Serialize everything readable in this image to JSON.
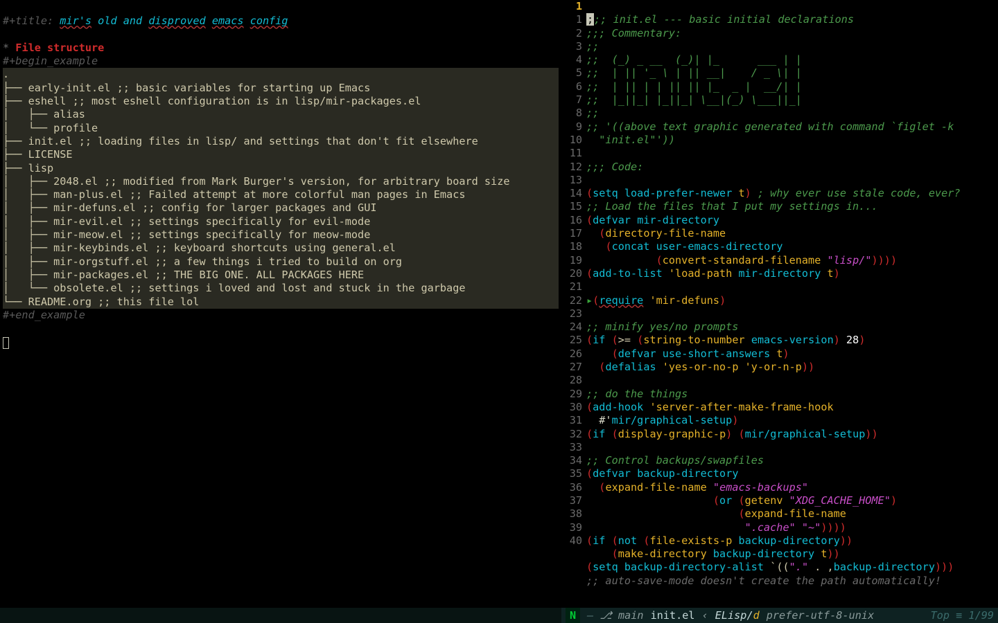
{
  "left": {
    "title_kw": "#+title: ",
    "title_words": [
      "mir's",
      "old",
      "and",
      "disproved",
      "emacs",
      "config"
    ],
    "heading_star": "* ",
    "heading": "File structure",
    "begin": "#+begin_example",
    "end": "#+end_example",
    "tree": [
      ".",
      "├── early-init.el ;; basic variables for starting up Emacs",
      "├── eshell ;; most eshell configuration is in lisp/mir-packages.el",
      "│   ├── alias",
      "│   └── profile",
      "├── init.el ;; loading files in lisp/ and settings that don't fit elsewhere",
      "├── LICENSE",
      "├── lisp",
      "│   ├── 2048.el ;; modified from Mark Burger's version, for arbitrary board size",
      "│   ├── man-plus.el ;; Failed attempt at more colorful man pages in Emacs",
      "│   ├── mir-defuns.el ;; config for larger packages and GUI",
      "│   ├── mir-evil.el ;; settings specifically for evil-mode",
      "│   ├── mir-meow.el ;; settings specifically for meow-mode",
      "│   ├── mir-keybinds.el ;; keyboard shortcuts using general.el",
      "│   ├── mir-orgstuff.el ;; a few things i tried to build on org",
      "│   ├── mir-packages.el ;; THE BIG ONE. ALL PACKAGES HERE",
      "│   └── obsolete.el ;; settings i loved and lost and stuck in the garbage",
      "└── README.org ;; this file lol"
    ]
  },
  "right": {
    "current_line_indicator": "1",
    "lines": [
      ";;; init.el --- basic initial declarations",
      ";;; Commentary:",
      ";;",
      ";;  (_) _ __  (_)| |_      ___ | |",
      ";;  | || '_ \\ | || __|    / _ \\| |",
      ";;  | || | | || || |_  _ |  __/| |",
      ";;  |_||_| |_||_| \\__|(_) \\___||_|",
      ";;",
      ";; '((above text graphic generated with command `figlet -k \"init.el\"'))",
      "",
      ";;; Code:",
      "",
      "(setq load-prefer-newer t) ; why ever use stale code, ever?",
      ";; Load the files that I put my settings in...",
      "(defvar mir-directory",
      "  (directory-file-name",
      "   (concat user-emacs-directory",
      "           (convert-standard-filename \"lisp/\"))))",
      "(add-to-list 'load-path mir-directory t)",
      "",
      "(require 'mir-defuns)",
      "",
      ";; minify yes/no prompts",
      "(if (>= (string-to-number emacs-version) 28)",
      "    (defvar use-short-answers t)",
      "  (defalias 'yes-or-no-p 'y-or-n-p))",
      "",
      ";; do the things",
      "(add-hook 'server-after-make-frame-hook #'mir/graphical-setup)",
      "(if (display-graphic-p) (mir/graphical-setup))",
      "",
      ";; Control backups/swapfiles",
      "(defvar backup-directory",
      "  (expand-file-name \"emacs-backups\"",
      "                    (or (getenv \"XDG_CACHE_HOME\")",
      "                        (expand-file-name",
      "                         \".cache\" \"~\"))))",
      "(if (not (file-exists-p backup-directory))",
      "    (make-directory backup-directory t))",
      "(setq backup-directory-alist `((\".\" . ,backup-directory)))",
      ";; auto-save-mode doesn't create the path automatically!"
    ],
    "indents": {
      "8": "  ",
      "15": "  ",
      "16": "   ",
      "17": "           ",
      "23": "    ",
      "24": "  ",
      "28b": "  ",
      "33": "  ",
      "34": "                    ",
      "35": "                        ",
      "36": "                         ",
      "38": "    "
    }
  },
  "status": {
    "n": "N",
    "dash": "—",
    "branch_icon": "⎇",
    "branch": "main",
    "file": "init.el",
    "chevron": "‹",
    "mode": "ELisp/",
    "mode_suffix": "d",
    "encoding": "prefer-utf-8-unix",
    "pos": "Top ≡ 1/99"
  }
}
